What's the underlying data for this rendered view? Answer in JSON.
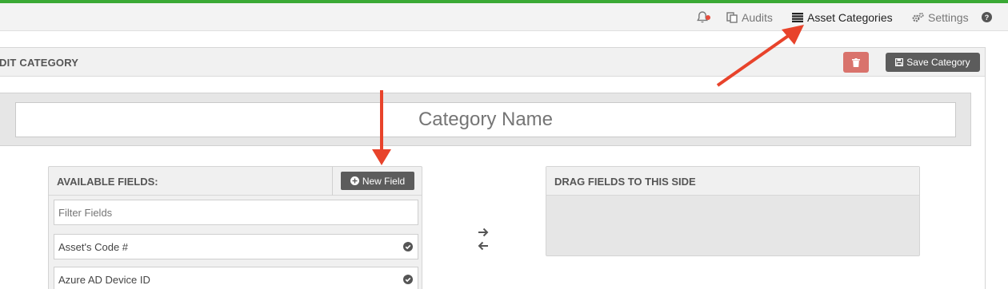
{
  "topnav": {
    "audits_label": "Audits",
    "asset_categories_label": "Asset Categories",
    "settings_label": "Settings"
  },
  "panel": {
    "title": "DIT CATEGORY",
    "save_label": "Save Category"
  },
  "category_name": {
    "placeholder": "Category Name"
  },
  "available_fields": {
    "title": "AVAILABLE FIELDS:",
    "new_field_label": "New Field",
    "filter_placeholder": "Filter Fields",
    "items": [
      {
        "label": "Asset's Code #"
      },
      {
        "label": "Azure AD Device ID"
      }
    ]
  },
  "drop_zone": {
    "title": "DRAG FIELDS TO THIS SIDE"
  },
  "colors": {
    "accent_bar": "#3aa935",
    "delete_button": "#d9736c",
    "dark_button": "#5c5c5c",
    "annotation_arrow": "#e8432b"
  },
  "icons": [
    "bell-icon",
    "audits-icon",
    "list-icon",
    "gears-icon",
    "help-icon",
    "trash-icon",
    "save-icon",
    "plus-circle-icon",
    "check-circle-icon",
    "arrow-right-icon",
    "arrow-left-icon"
  ]
}
